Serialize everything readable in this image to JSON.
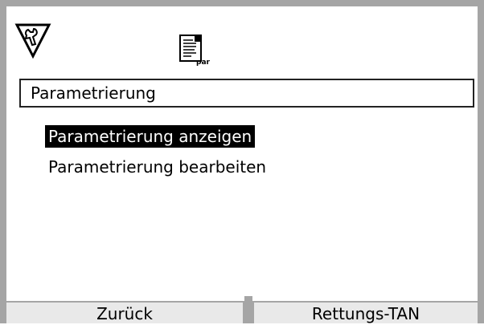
{
  "header": {
    "icons": [
      "wrench-triangle-icon",
      "parameter-document-icon"
    ],
    "doc_icon_text": "par"
  },
  "title": "Parametrierung",
  "menu": {
    "items": [
      {
        "label": "Parametrierung anzeigen",
        "selected": true
      },
      {
        "label": "Parametrierung bearbeiten",
        "selected": false
      }
    ]
  },
  "softkeys": {
    "left": "Zurück",
    "right": "Rettungs-TAN"
  },
  "colors": {
    "frame": "#a5a5a5",
    "selection": "#000000",
    "softkey_bg": "#e9e9e9"
  }
}
